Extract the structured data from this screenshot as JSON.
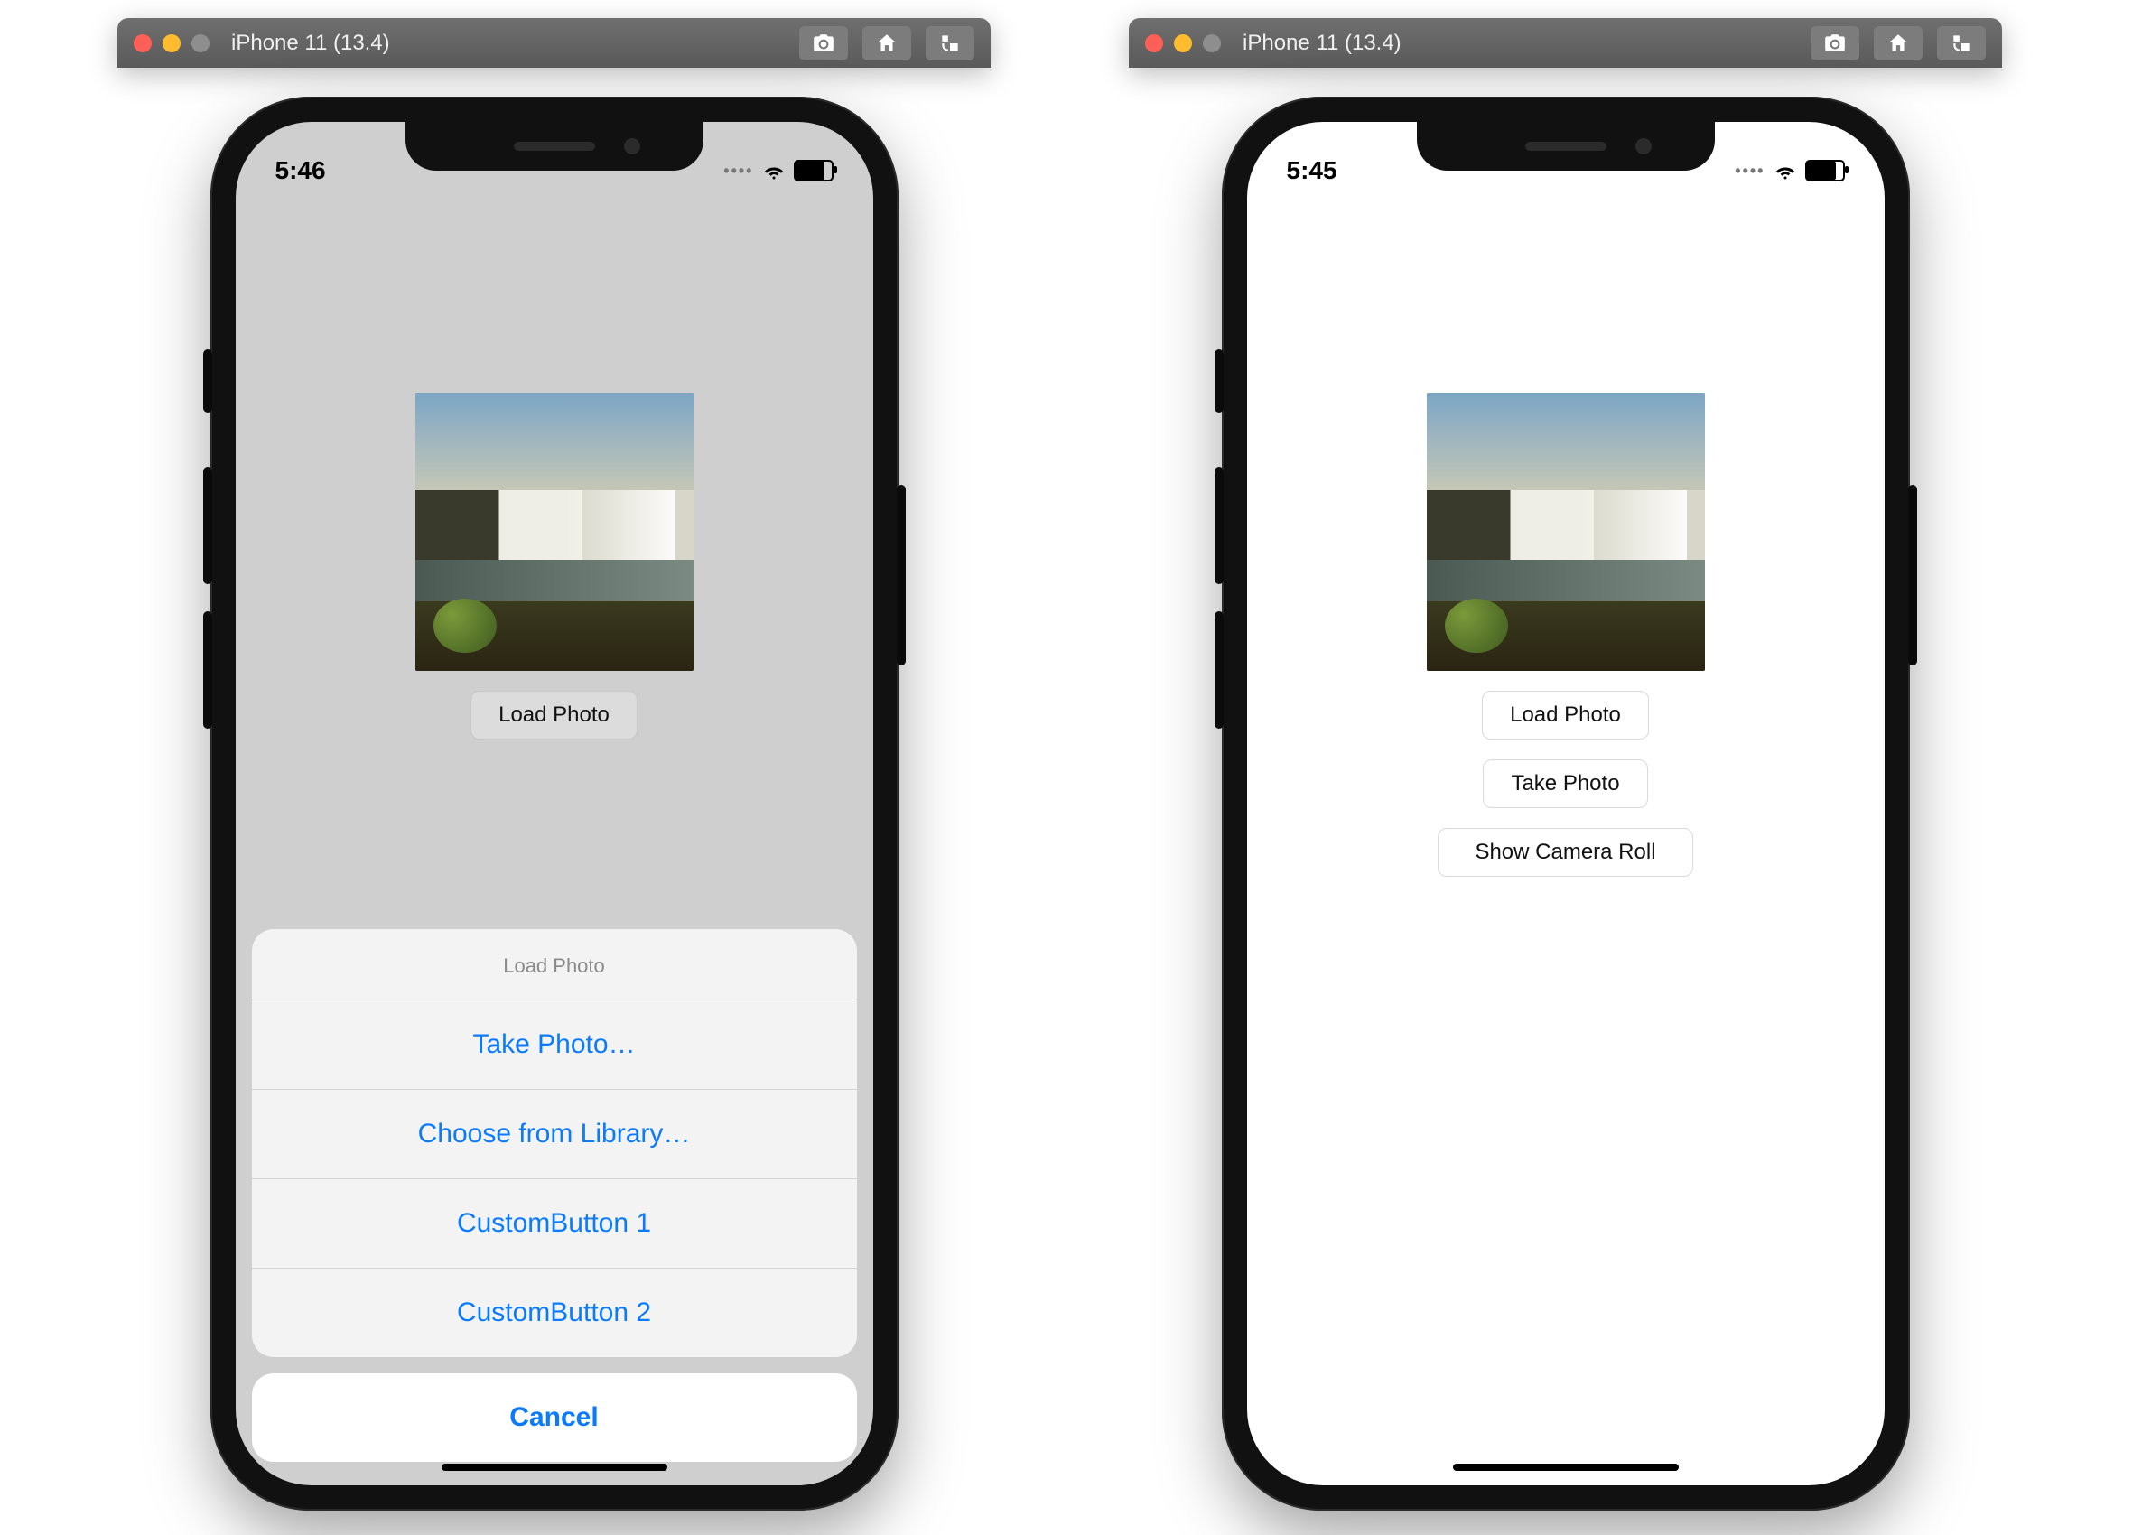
{
  "window": {
    "title": "iPhone 11 (13.4)"
  },
  "left": {
    "time": "5:46",
    "loadButton": "Load Photo",
    "sheet": {
      "title": "Load Photo",
      "takePhoto": "Take Photo…",
      "chooseLibrary": "Choose from Library…",
      "custom1": "CustomButton 1",
      "custom2": "CustomButton 2",
      "cancel": "Cancel"
    }
  },
  "right": {
    "time": "5:45",
    "buttons": {
      "load": "Load Photo",
      "take": "Take Photo",
      "roll": "Show Camera Roll"
    }
  }
}
